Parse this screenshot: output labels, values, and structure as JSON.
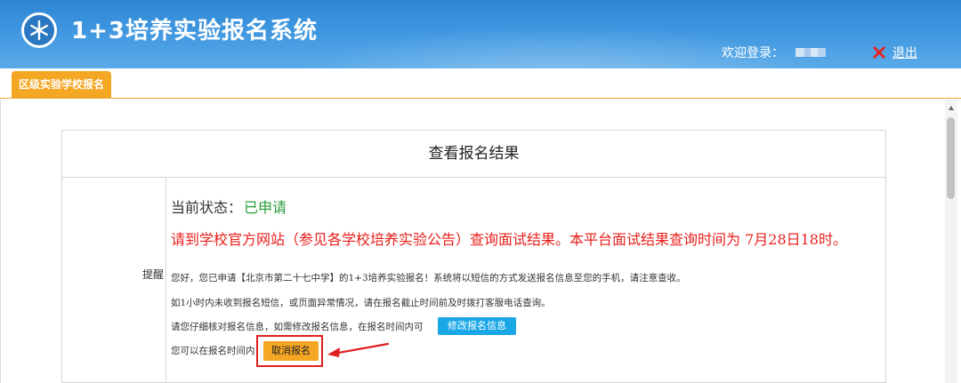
{
  "header": {
    "app_title": "1+3培养实验报名系统",
    "welcome_label": "欢迎登录：",
    "logout_label": "退出"
  },
  "tabs": [
    {
      "label": "区级实验学校报名",
      "active": true
    }
  ],
  "result_panel": {
    "title": "查看报名结果",
    "reminder_label": "提醒",
    "status_label": "当前状态：",
    "status_value": "已申请",
    "notice": "请到学校官方网站（参见各学校培养实验公告）查询面试结果。本平台面试结果查询时间为 7月28日18时。",
    "messages": [
      "您好，您已申请【北京市第二十七中学】的1+3培养实验报名！系统将以短信的方式发送报名信息至您的手机，请注意查收。",
      "如1小时内未收到报名短信，或页面异常情况，请在报名截止时间前及时拨打客服电话查询。",
      "请您仔细核对报名信息，如需修改报名信息，在报名时间内可",
      "您可以在报名时间内"
    ],
    "modify_button": "修改报名信息",
    "cancel_button": "取消报名"
  },
  "colors": {
    "header_blue": "#3f97e0",
    "tab_orange": "#f3a722",
    "status_green": "#2a9d3a",
    "notice_red": "#e8201c",
    "modify_button_blue": "#1aa7e6",
    "cancel_button_orange": "#f5a623",
    "highlight_red": "#e02020"
  },
  "icons": {
    "logo": "snowflake-emblem-icon",
    "logout": "red-x-icon",
    "scroll_up": "triangle-up-icon",
    "annotation": "red-arrow-icon"
  }
}
